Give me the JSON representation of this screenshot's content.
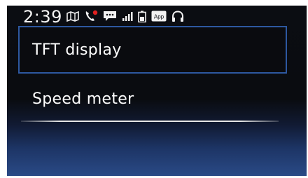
{
  "status_bar": {
    "time": "2:39",
    "app_badge": "App",
    "icons": [
      "map-icon",
      "phone-icon",
      "notification-dot-icon",
      "message-icon",
      "signal-icon",
      "battery-icon",
      "app-icon",
      "headphones-icon"
    ],
    "missed_call_color": "#e02020"
  },
  "menu": {
    "items": [
      {
        "label": "TFT display",
        "selected": true
      },
      {
        "label": "Speed meter",
        "selected": false
      }
    ]
  },
  "colors": {
    "selection_border": "#2d58a0",
    "background_bottom": "#2a4a86"
  }
}
